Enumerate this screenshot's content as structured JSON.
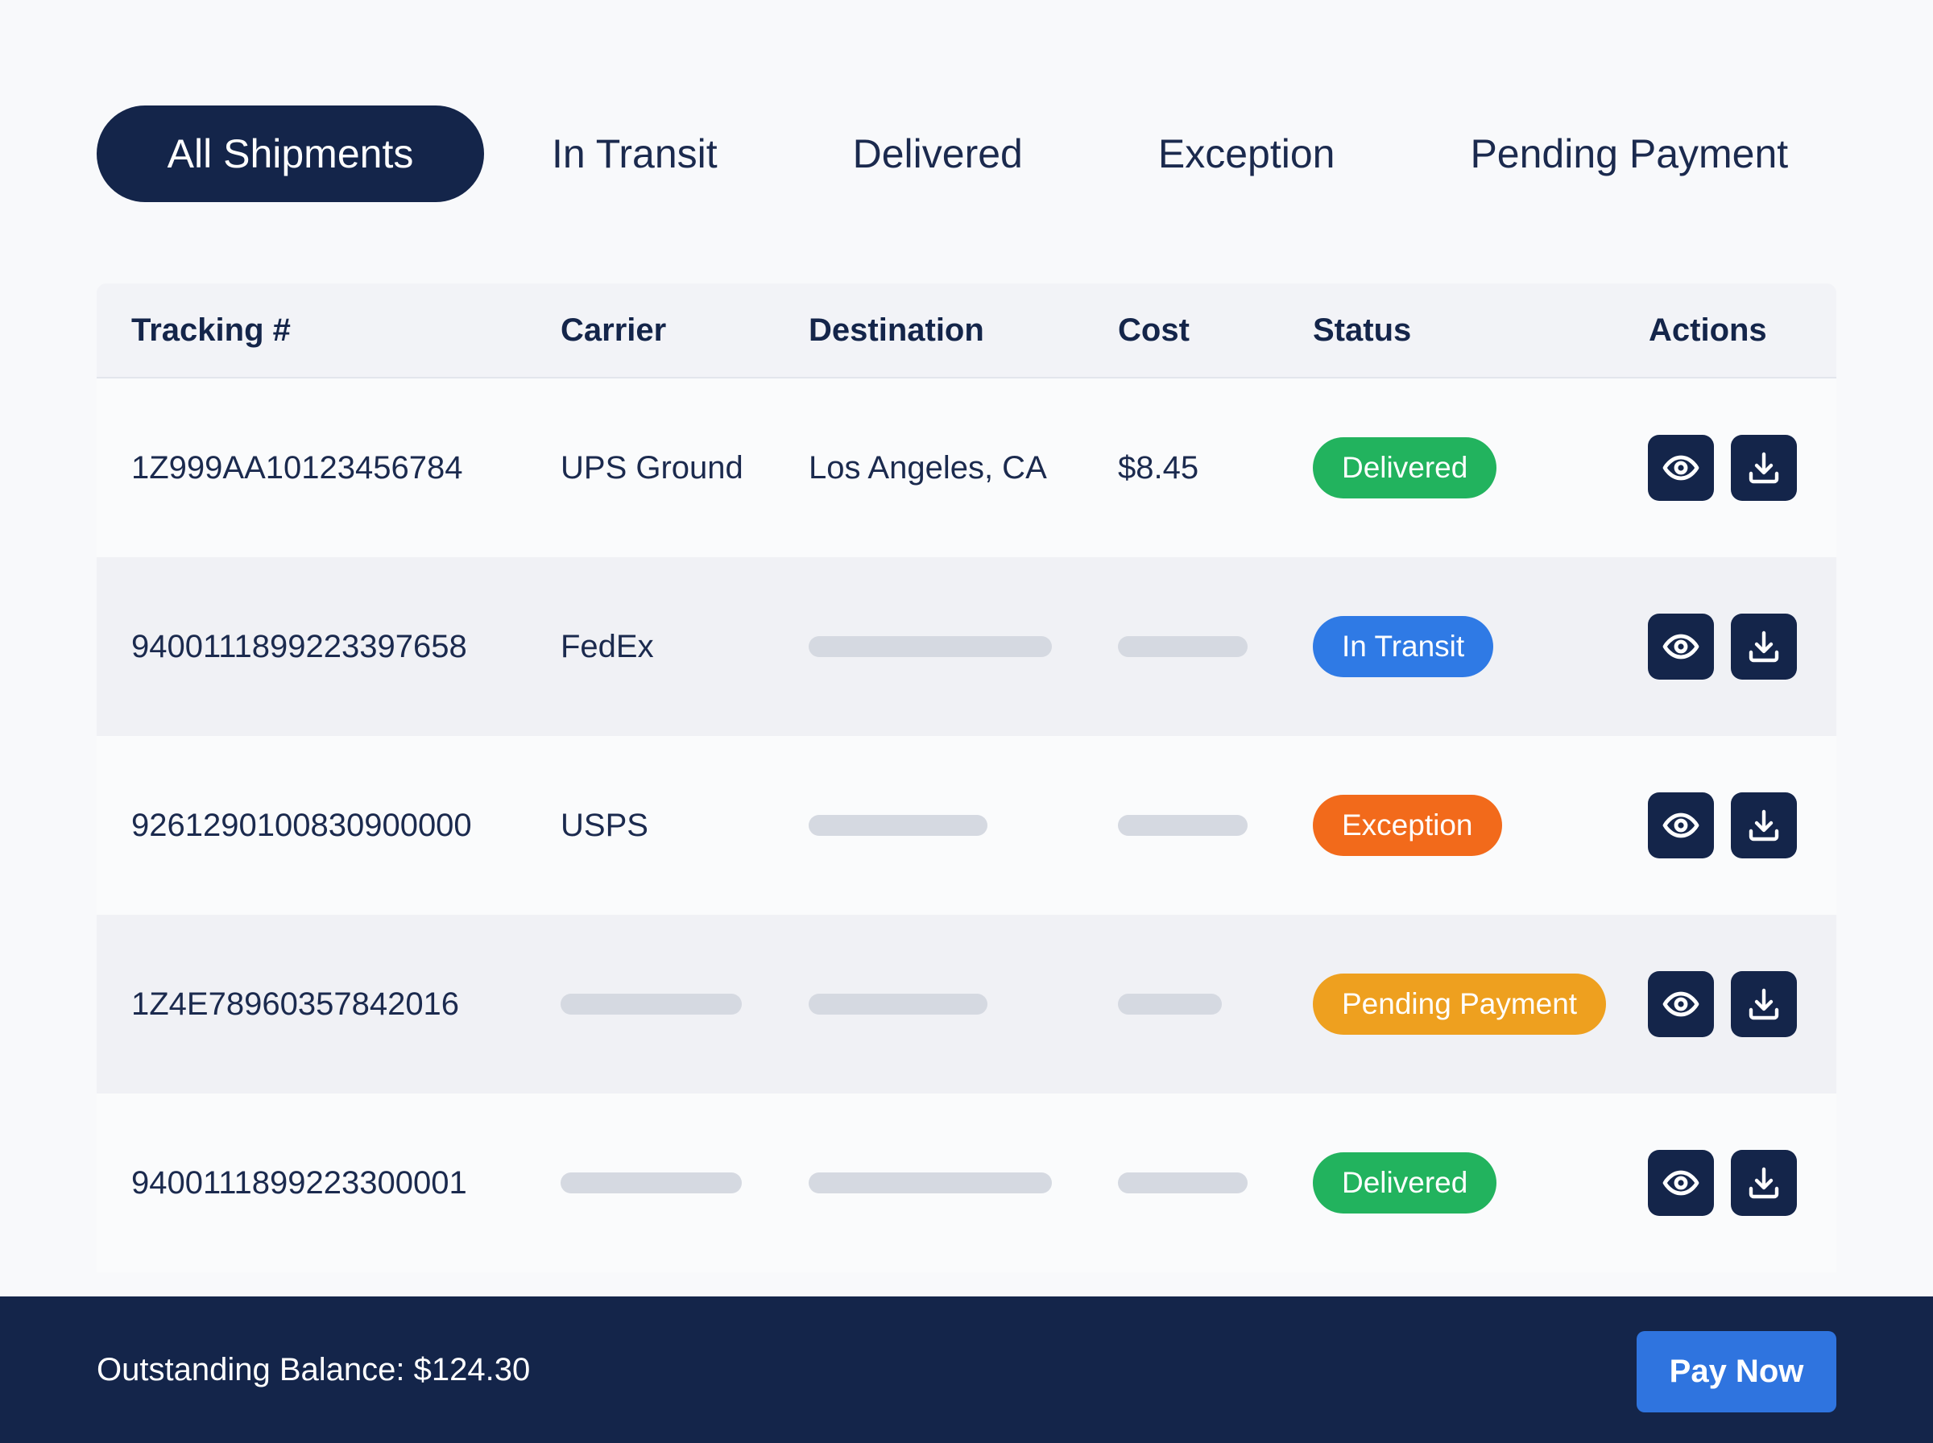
{
  "tabs": [
    {
      "label": "All Shipments",
      "active": true
    },
    {
      "label": "In Transit",
      "active": false
    },
    {
      "label": "Delivered",
      "active": false
    },
    {
      "label": "Exception",
      "active": false
    },
    {
      "label": "Pending Payment",
      "active": false
    }
  ],
  "table": {
    "headers": [
      "Tracking #",
      "Carrier",
      "Destination",
      "Cost",
      "Status",
      "Actions"
    ],
    "rows": [
      {
        "tracking": "1Z999AA10123456784",
        "carrier": "UPS Ground",
        "destination": "Los Angeles, CA",
        "cost": "$8.45",
        "status": "Delivered",
        "status_color": "#22b35e"
      },
      {
        "tracking": "9400111899223397658",
        "carrier": "FedEx",
        "destination": null,
        "cost": null,
        "status": "In Transit",
        "status_color": "#2f7ae5"
      },
      {
        "tracking": "9261290100830900000",
        "carrier": "USPS",
        "destination": null,
        "cost": null,
        "status": "Exception",
        "status_color": "#f26a1b"
      },
      {
        "tracking": "1Z4E78960357842016",
        "carrier": null,
        "destination": null,
        "cost": null,
        "status": "Pending Payment",
        "status_color": "#eea01f"
      },
      {
        "tracking": "9400111899223300001",
        "carrier": null,
        "destination": null,
        "cost": null,
        "status": "Delivered",
        "status_color": "#22b35e"
      }
    ],
    "action_icons": [
      "eye-icon",
      "download-icon"
    ]
  },
  "footer": {
    "balance_text": "Outstanding Balance: $124.30",
    "pay_label": "Pay Now"
  },
  "colors": {
    "navy": "#14254a",
    "accent_blue": "#2f74df",
    "skeleton": "#d5d9e1"
  }
}
